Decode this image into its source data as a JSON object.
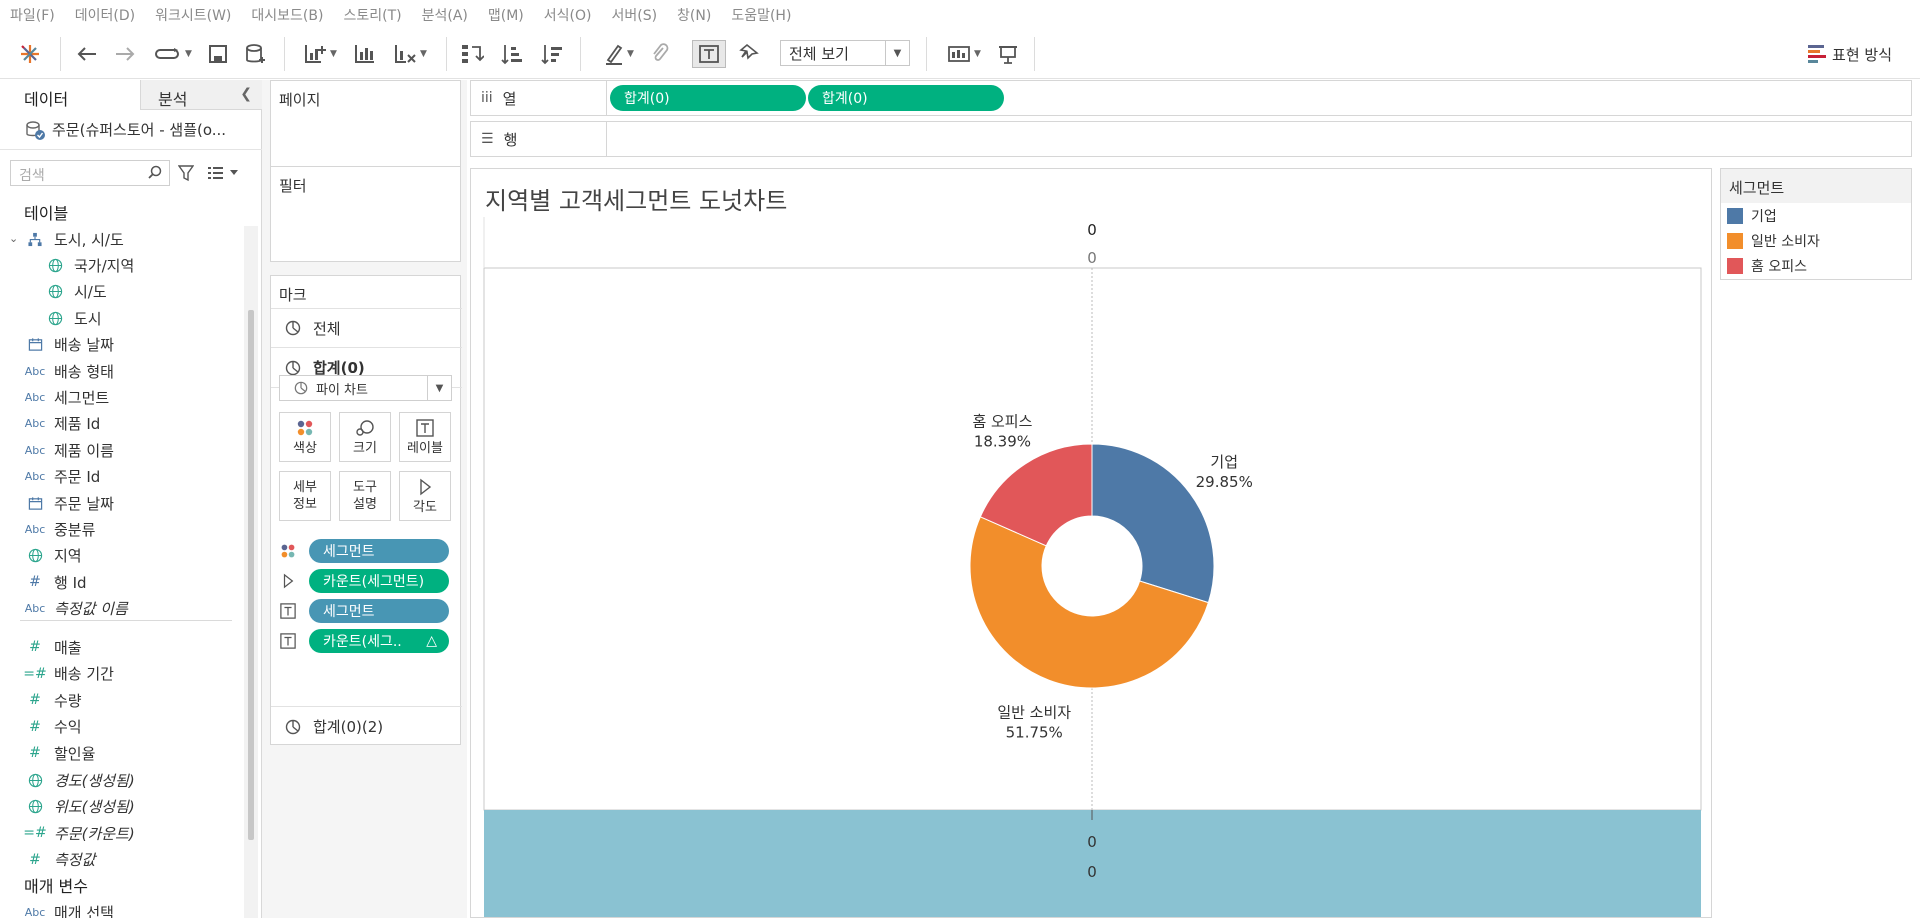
{
  "menu": [
    "파일(F)",
    "데이터(D)",
    "워크시트(W)",
    "대시보드(B)",
    "스토리(T)",
    "분석(A)",
    "맵(M)",
    "서식(O)",
    "서버(S)",
    "창(N)",
    "도움말(H)"
  ],
  "toolbar": {
    "view_mode": "전체 보기",
    "show_me": "표현 방식"
  },
  "data_pane": {
    "tab_data": "데이터",
    "tab_analysis": "분석",
    "datasource": "주문(슈퍼스토어 - 샘플(o...",
    "search_placeholder": "검색",
    "tables_heading": "테이블",
    "dimensions": [
      {
        "label": "도시, 시/도",
        "icon": "hierarchy-icon",
        "indent": 0,
        "italic": false
      },
      {
        "label": "국가/지역",
        "icon": "globe-icon",
        "indent": 1,
        "italic": false
      },
      {
        "label": "시/도",
        "icon": "globe-icon",
        "indent": 1,
        "italic": false
      },
      {
        "label": "도시",
        "icon": "globe-icon",
        "indent": 1,
        "italic": false
      },
      {
        "label": "배송 날짜",
        "icon": "calendar-icon",
        "indent": 0,
        "italic": false
      },
      {
        "label": "배송 형태",
        "icon": "Abc",
        "indent": 0,
        "italic": false
      },
      {
        "label": "세그먼트",
        "icon": "Abc",
        "indent": 0,
        "italic": false
      },
      {
        "label": "제품 Id",
        "icon": "Abc",
        "indent": 0,
        "italic": false
      },
      {
        "label": "제품 이름",
        "icon": "Abc",
        "indent": 0,
        "italic": false
      },
      {
        "label": "주문 Id",
        "icon": "Abc",
        "indent": 0,
        "italic": false
      },
      {
        "label": "주문 날짜",
        "icon": "calendar-icon",
        "indent": 0,
        "italic": false
      },
      {
        "label": "중분류",
        "icon": "Abc",
        "indent": 0,
        "italic": false
      },
      {
        "label": "지역",
        "icon": "globe-icon",
        "indent": 0,
        "italic": false
      },
      {
        "label": "행 Id",
        "icon": "#",
        "indent": 0,
        "italic": false
      },
      {
        "label": "측정값 이름",
        "icon": "Abc",
        "indent": 0,
        "italic": true
      }
    ],
    "measures": [
      {
        "label": "매출",
        "icon": "#",
        "italic": false
      },
      {
        "label": "배송 기간",
        "icon": "=#",
        "italic": false
      },
      {
        "label": "수량",
        "icon": "#",
        "italic": false
      },
      {
        "label": "수익",
        "icon": "#",
        "italic": false
      },
      {
        "label": "할인율",
        "icon": "#",
        "italic": false
      },
      {
        "label": "경도(생성됨)",
        "icon": "globe-icon",
        "italic": true
      },
      {
        "label": "위도(생성됨)",
        "icon": "globe-icon",
        "italic": true
      },
      {
        "label": "주문(카운트)",
        "icon": "=#",
        "italic": true
      },
      {
        "label": "측정값",
        "icon": "#",
        "italic": true
      }
    ],
    "parameters_heading": "매개 변수",
    "parameters": [
      {
        "label": "매개 선택",
        "icon": "Abc"
      }
    ]
  },
  "shelves": {
    "pages": "페이지",
    "filters": "필터",
    "marks": "마크",
    "marks_all": "전체",
    "marks_sum1": "합계(0)",
    "mark_type": "파이 차트",
    "buttons": {
      "color": "색상",
      "size": "크기",
      "label": "레이블",
      "detail": "세부\n정보",
      "tooltip": "도구\n설명",
      "angle": "각도"
    },
    "mark_pills": [
      {
        "label": "세그먼트",
        "kind": "blue",
        "icon": "color-dots-icon"
      },
      {
        "label": "카운트(세그먼트)",
        "kind": "green",
        "icon": "angle-icon"
      },
      {
        "label": "세그먼트",
        "kind": "blue",
        "icon": "label-icon"
      },
      {
        "label": "카운트(세그..",
        "kind": "green",
        "icon": "label-icon",
        "delta": "△"
      }
    ],
    "marks_sum2": "합계(0)(2)",
    "columns_label": "열",
    "rows_label": "행",
    "column_pills": [
      "합계(0)",
      "합계(0)"
    ]
  },
  "viz": {
    "title": "지역별 고객세그먼트 도넛차트",
    "top_header_1": "0",
    "top_header_2": "0",
    "bottom_label_1": "0",
    "bottom_label_2": "0"
  },
  "legend": {
    "title": "세그먼트",
    "items": [
      {
        "label": "기업",
        "color": "#4e79a7"
      },
      {
        "label": "일반 소비자",
        "color": "#f28e2b"
      },
      {
        "label": "홈 오피스",
        "color": "#e15759"
      }
    ]
  },
  "chart_data": {
    "type": "pie",
    "categories": [
      "기업",
      "일반 소비자",
      "홈 오피스"
    ],
    "values": [
      29.85,
      51.75,
      18.39
    ],
    "labels": [
      "29.85%",
      "51.75%",
      "18.39%"
    ],
    "colors": [
      "#4e79a7",
      "#f28e2b",
      "#e15759"
    ],
    "donut": true,
    "bottom_band_color": "#8ac2d2"
  }
}
